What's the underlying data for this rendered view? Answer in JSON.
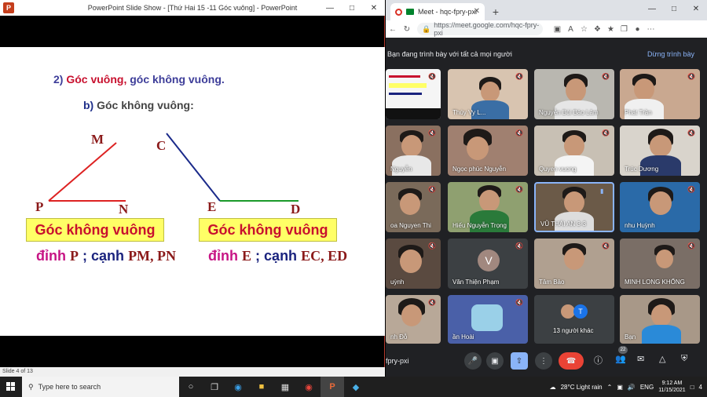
{
  "ppt": {
    "title": "PowerPoint Slide Show - [Thứ Hai 15 -11 Góc vuông] - PowerPoint",
    "status": "Slide 4 of 13",
    "slide": {
      "heading_prefix": "2)",
      "heading_red": "Góc vuông,",
      "heading_rest": "góc không vuông.",
      "sub_prefix": "b)",
      "sub_text": "Góc không vuông:",
      "left": {
        "vertex_labels": {
          "top": "M",
          "vertex": "P",
          "right": "N"
        },
        "box": "Góc không vuông",
        "dinh": "đỉnh",
        "vertex": "P",
        "canh": "; cạnh",
        "sides": "PM, PN"
      },
      "right": {
        "vertex_labels": {
          "top": "C",
          "vertex": "E",
          "right": "D"
        },
        "box": "Góc không vuông",
        "dinh": "đỉnh",
        "vertex": "E",
        "canh": "; cạnh",
        "sides": "EC, ED"
      }
    }
  },
  "browser": {
    "tab_title": "Meet - hqc-fpry-pxi",
    "url": "https://meet.google.com/hqc-fpry-pxi",
    "present_banner": "Bạn đang trình bày với tất cả mọi người",
    "stop_present": "Dừng trình bày"
  },
  "meet": {
    "participants": [
      {
        "name": ""
      },
      {
        "name": "Thúy Vy L..."
      },
      {
        "name": "Nguyễn Bùi Bảo Lâm"
      },
      {
        "name": "Phát Trần"
      },
      {
        "name": "Nguyễn"
      },
      {
        "name": "Ngọc phúc Nguyễn"
      },
      {
        "name": "Quyen vuong"
      },
      {
        "name": "Trúc Dương"
      },
      {
        "name": "oa Nguyen Thi"
      },
      {
        "name": "Hiếu Nguyễn Trọng"
      },
      {
        "name": "VŨ THÁI AN 3-3"
      },
      {
        "name": "nhu Huỳnh"
      },
      {
        "name": "uỳnh"
      },
      {
        "name": "Văn Thiện Phạm"
      },
      {
        "name": "Tâm Bảo"
      },
      {
        "name": "MINH LONG KHỔNG"
      },
      {
        "name": "nh Đỗ"
      },
      {
        "name": "ần Hoài"
      },
      {
        "name": "13 người khác"
      },
      {
        "name": "Bạn"
      }
    ],
    "avatar_letter": "V",
    "others_letter": "T",
    "meeting_code": "fpry-pxi",
    "people_count": "22"
  },
  "taskbar": {
    "search_placeholder": "Type here to search",
    "weather": "28°C Light rain",
    "lang": "ENG",
    "time": "9:12 AM",
    "date": "11/15/2021",
    "notif": "4"
  },
  "colors": {
    "accent_red": "#c8102e",
    "meet_blue": "#8ab4f8",
    "leave_red": "#ea4335"
  }
}
